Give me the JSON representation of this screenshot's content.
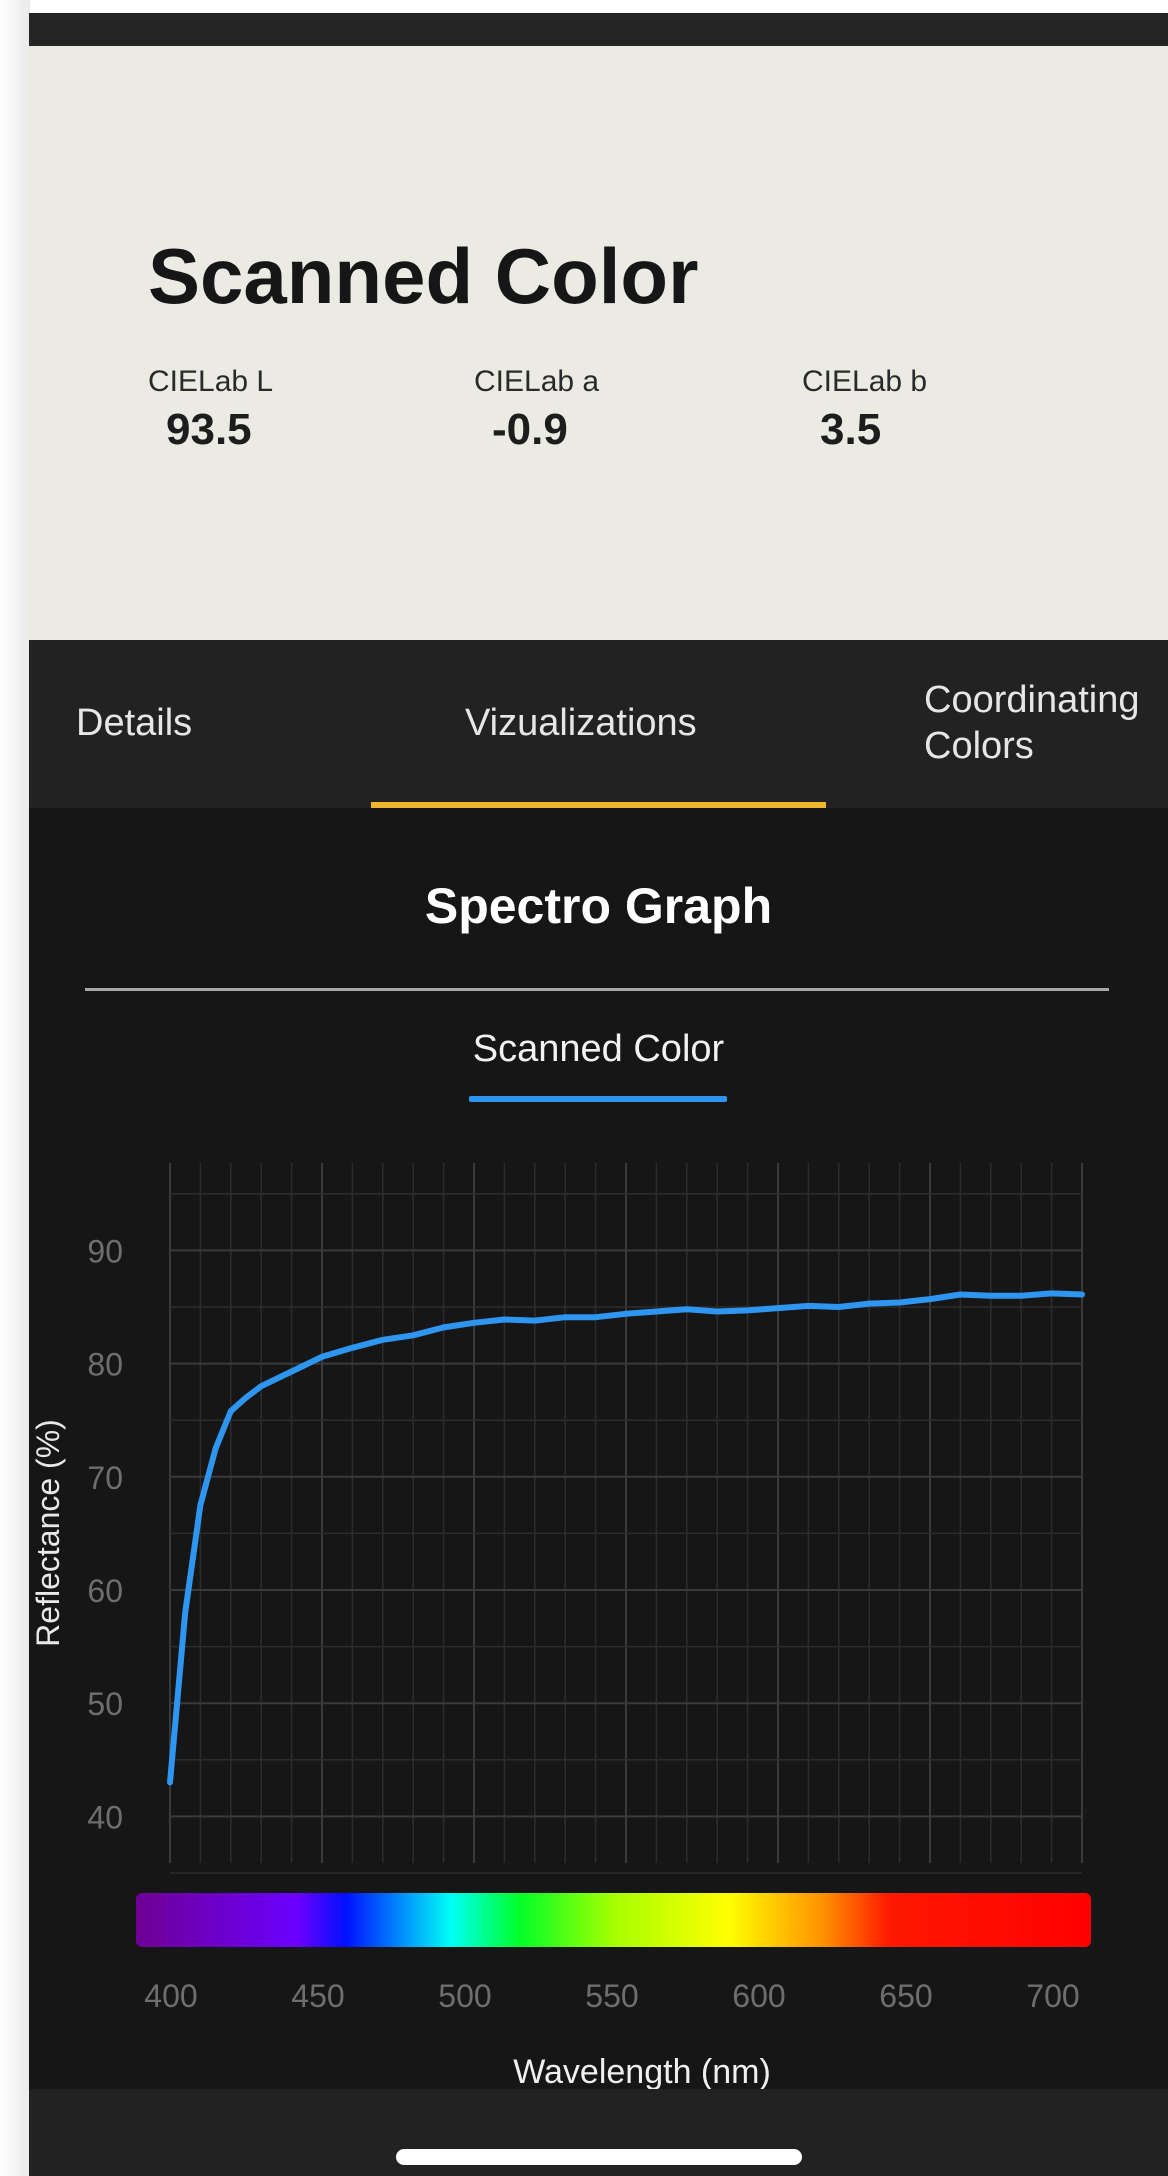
{
  "header": {
    "title": "Scanned Color",
    "swatch_color": "#EBEBE4",
    "values": [
      {
        "label": "CIELab L",
        "value": "93.5"
      },
      {
        "label": "CIELab a",
        "value": "-0.9"
      },
      {
        "label": "CIELab b",
        "value": "3.5"
      }
    ]
  },
  "tabs": [
    {
      "label": "Details",
      "active": false
    },
    {
      "label": "Vizualizations",
      "active": true
    },
    {
      "label": "Coordinating Colors",
      "active": false
    }
  ],
  "accent_color": "#F0B52E",
  "viz": {
    "title": "Spectro Graph",
    "legend": "Scanned Color",
    "series_color": "#2E96F0"
  },
  "chart_data": {
    "type": "line",
    "xlabel": "Wavelength (nm)",
    "ylabel": "Reflectance (%)",
    "xlim": [
      400,
      700
    ],
    "ylim": [
      35,
      97
    ],
    "x_ticks": [
      400,
      450,
      500,
      550,
      600,
      650,
      700
    ],
    "y_ticks": [
      40,
      50,
      60,
      70,
      80,
      90
    ],
    "grid": true,
    "spectrum_bar": true,
    "series": [
      {
        "name": "Scanned Color",
        "x": [
          400,
          405,
          410,
          415,
          420,
          425,
          430,
          440,
          450,
          460,
          470,
          480,
          490,
          500,
          510,
          520,
          530,
          540,
          550,
          560,
          570,
          580,
          590,
          600,
          610,
          620,
          630,
          640,
          650,
          660,
          670,
          680,
          690,
          700
        ],
        "values": [
          43.0,
          58.0,
          67.5,
          72.5,
          75.8,
          77.0,
          78.0,
          79.3,
          80.6,
          81.4,
          82.1,
          82.5,
          83.2,
          83.6,
          83.9,
          83.8,
          84.1,
          84.1,
          84.4,
          84.6,
          84.8,
          84.6,
          84.7,
          84.9,
          85.1,
          85.0,
          85.3,
          85.4,
          85.7,
          86.1,
          86.0,
          86.0,
          86.2,
          86.1
        ]
      }
    ]
  }
}
